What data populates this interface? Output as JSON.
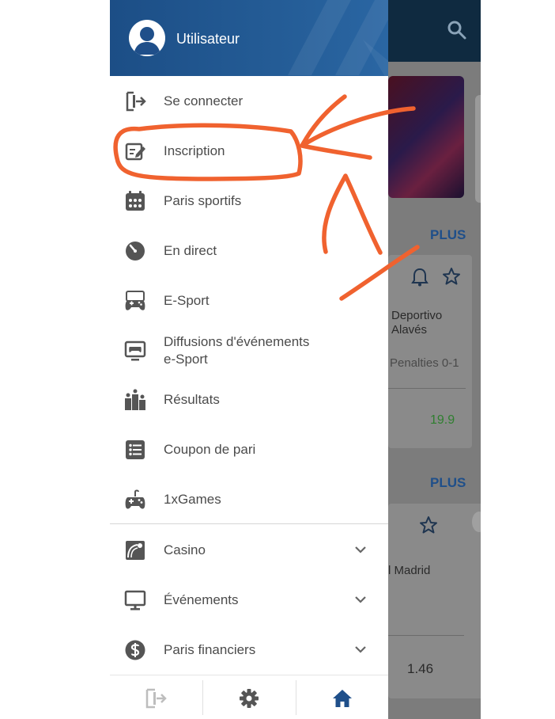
{
  "user": {
    "name": "Utilisateur"
  },
  "menu": {
    "items": [
      {
        "label": "Se connecter",
        "icon": "login-icon"
      },
      {
        "label": "Inscription",
        "icon": "edit-form-icon"
      },
      {
        "label": "Paris sportifs",
        "icon": "calendar-icon"
      },
      {
        "label": "En direct",
        "icon": "stopwatch-icon"
      },
      {
        "label": "E-Sport",
        "icon": "gamepad-icon"
      },
      {
        "label": "Diffusions d'événements",
        "label2": "e-Sport",
        "icon": "monitor-gamepad-icon"
      },
      {
        "label": "Résultats",
        "icon": "podium-icon"
      },
      {
        "label": "Coupon de pari",
        "icon": "list-icon"
      },
      {
        "label": "1xGames",
        "icon": "joystick-icon"
      }
    ],
    "expandable": [
      {
        "label": "Casino",
        "icon": "casino-icon"
      },
      {
        "label": "Événements",
        "icon": "desktop-icon"
      },
      {
        "label": "Paris financiers",
        "icon": "dollar-coin-icon"
      }
    ]
  },
  "bottom_bar": {
    "icons": [
      "logout-icon",
      "gear-icon",
      "home-icon"
    ]
  },
  "background": {
    "section_action": "PLUS",
    "match1": {
      "team_line1": "Deportivo",
      "team_line2": "Alavés",
      "status": "Penalties 0-1",
      "odd": "19.9"
    },
    "match2": {
      "team": "l Madrid",
      "odd": "1.46"
    }
  },
  "colors": {
    "header": "#245c96",
    "accent": "#1f4f8a",
    "annotation": "#f0622f",
    "odd_green": "#2f7f2f"
  }
}
